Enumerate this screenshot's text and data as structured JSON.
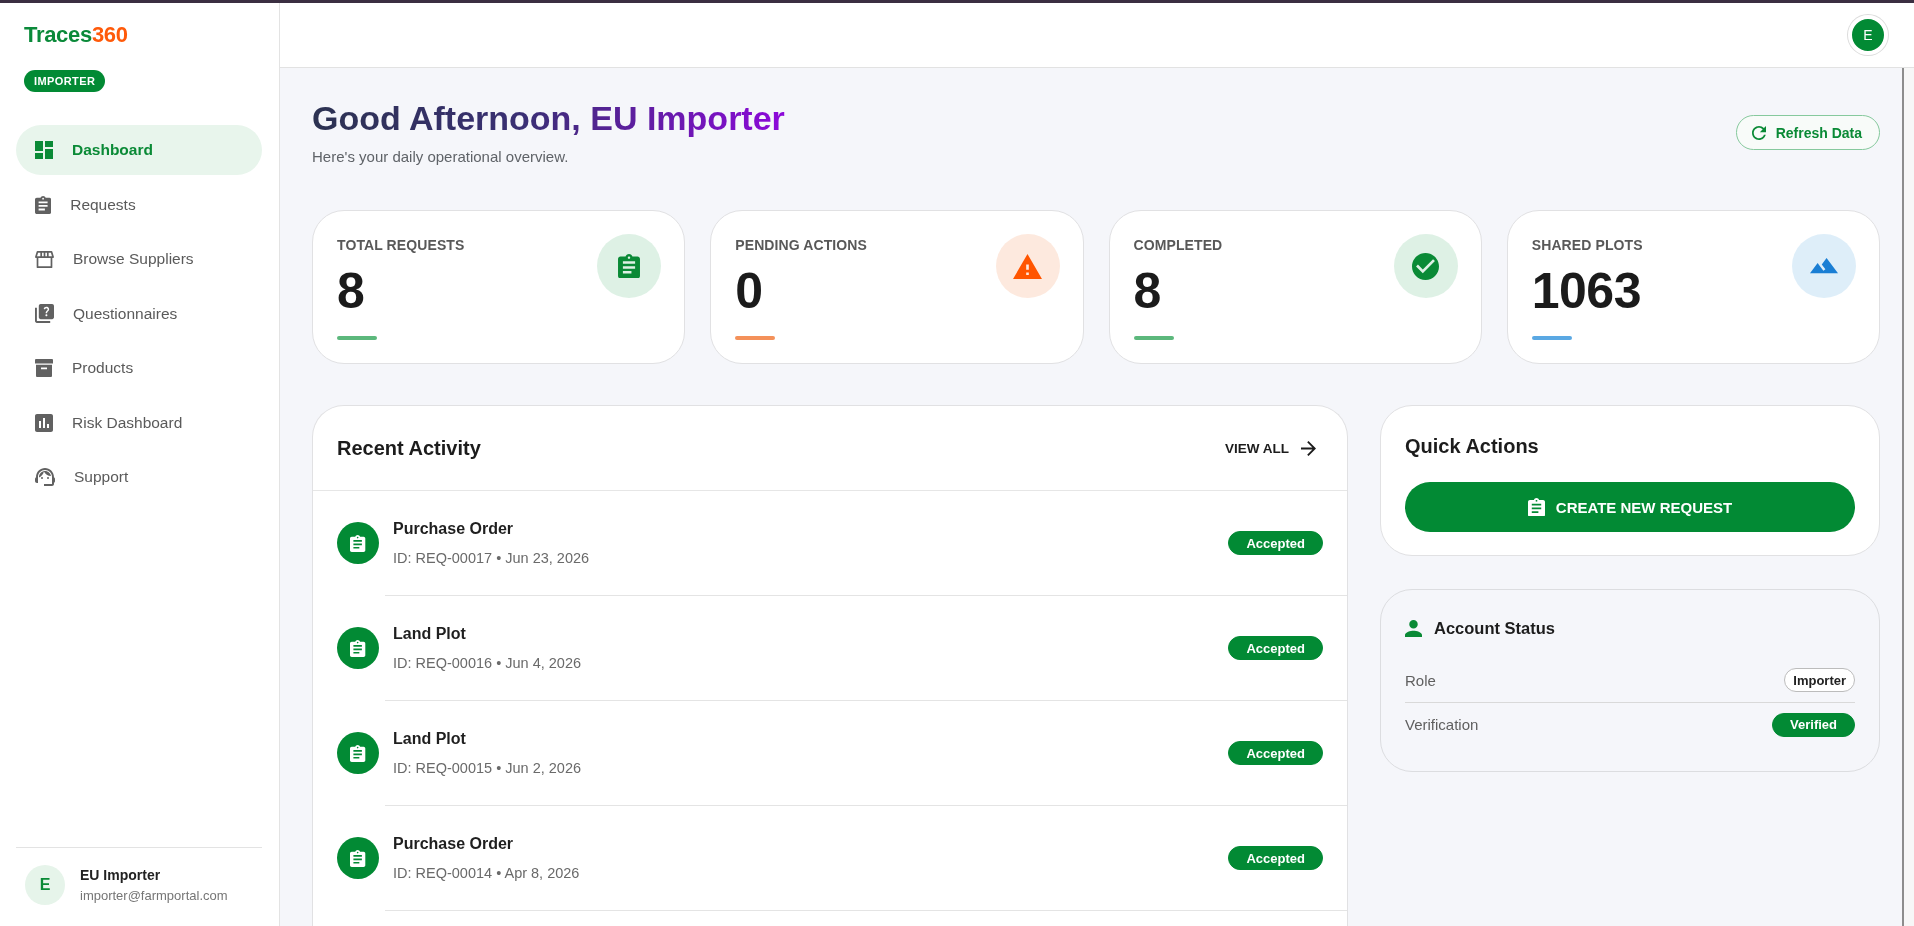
{
  "sidebar": {
    "logo": {
      "name": "Traces",
      "accent": "360"
    },
    "role_badge": "IMPORTER",
    "items": [
      {
        "label": "Dashboard",
        "selected": true
      },
      {
        "label": "Requests",
        "selected": false
      },
      {
        "label": "Browse Suppliers",
        "selected": false
      },
      {
        "label": "Questionnaires",
        "selected": false
      },
      {
        "label": "Products",
        "selected": false
      },
      {
        "label": "Risk Dashboard",
        "selected": false
      },
      {
        "label": "Support",
        "selected": false
      }
    ],
    "user": {
      "initial": "E",
      "name": "EU Importer",
      "email": "importer@farmportal.com"
    }
  },
  "header": {
    "avatar": "E"
  },
  "greeting": {
    "title": "Good Afternoon, EU Importer",
    "subtitle": "Here's your daily operational overview.",
    "refresh_button": "Refresh Data"
  },
  "stats": [
    {
      "label": "TOTAL REQUESTS",
      "value": "8",
      "color": "#5cb87c"
    },
    {
      "label": "PENDING ACTIONS",
      "value": "0",
      "color": "#f4915a"
    },
    {
      "label": "COMPLETED",
      "value": "8",
      "color": "#5cb87c"
    },
    {
      "label": "SHARED PLOTS",
      "value": "1063",
      "color": "#5aa8e3"
    }
  ],
  "recent_activity": {
    "title": "Recent Activity",
    "view_all": "VIEW ALL",
    "rows": [
      {
        "title": "Purchase Order",
        "meta": "ID: REQ-00017 • Jun 23, 2026",
        "status": "Accepted"
      },
      {
        "title": "Land Plot",
        "meta": "ID: REQ-00016 • Jun 4, 2026",
        "status": "Accepted"
      },
      {
        "title": "Land Plot",
        "meta": "ID: REQ-00015 • Jun 2, 2026",
        "status": "Accepted"
      },
      {
        "title": "Purchase Order",
        "meta": "ID: REQ-00014 • Apr 8, 2026",
        "status": "Accepted"
      }
    ]
  },
  "quick_actions": {
    "title": "Quick Actions",
    "button": "CREATE NEW REQUEST"
  },
  "account_status": {
    "title": "Account Status",
    "rows": [
      {
        "label": "Role",
        "value": "Importer",
        "kind": "outline"
      },
      {
        "label": "Verification",
        "value": "Verified",
        "kind": "filled"
      }
    ]
  }
}
